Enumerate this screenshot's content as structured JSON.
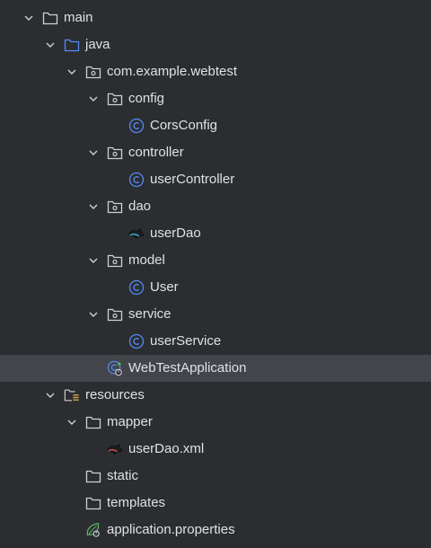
{
  "project_tree": {
    "main": {
      "label": "main",
      "icon": "folder-icon",
      "expanded": true
    },
    "java": {
      "label": "java",
      "icon": "source-root-folder-icon",
      "expanded": true
    },
    "package_root": {
      "label": "com.example.webtest",
      "icon": "package-icon",
      "expanded": true
    },
    "config": {
      "label": "config",
      "icon": "package-icon",
      "expanded": true
    },
    "cors_config": {
      "label": "CorsConfig",
      "icon": "class-icon"
    },
    "controller": {
      "label": "controller",
      "icon": "package-icon",
      "expanded": true
    },
    "user_controller": {
      "label": "userController",
      "icon": "class-icon"
    },
    "dao": {
      "label": "dao",
      "icon": "package-icon",
      "expanded": true
    },
    "user_dao": {
      "label": "userDao",
      "icon": "mybatis-interface-icon"
    },
    "model": {
      "label": "model",
      "icon": "package-icon",
      "expanded": true
    },
    "user": {
      "label": "User",
      "icon": "class-icon"
    },
    "service": {
      "label": "service",
      "icon": "package-icon",
      "expanded": true
    },
    "user_service": {
      "label": "userService",
      "icon": "class-icon"
    },
    "app": {
      "label": "WebTestApplication",
      "icon": "spring-boot-application-icon",
      "selected": true
    },
    "resources": {
      "label": "resources",
      "icon": "resources-root-folder-icon",
      "expanded": true
    },
    "mapper": {
      "label": "mapper",
      "icon": "folder-icon",
      "expanded": true
    },
    "user_dao_xml": {
      "label": "userDao.xml",
      "icon": "mybatis-xml-icon"
    },
    "static": {
      "label": "static",
      "icon": "folder-icon"
    },
    "templates": {
      "label": "templates",
      "icon": "folder-icon"
    },
    "app_properties": {
      "label": "application.properties",
      "icon": "spring-properties-icon"
    }
  },
  "colors": {
    "background": "#2b2d30",
    "selected_row": "#43454a",
    "text": "#dfe1e5",
    "icon_gray": "#ced0d6",
    "java_blue": "#548af7",
    "spring_green": "#5fb865",
    "mybatis_red": "#c94f4f"
  }
}
